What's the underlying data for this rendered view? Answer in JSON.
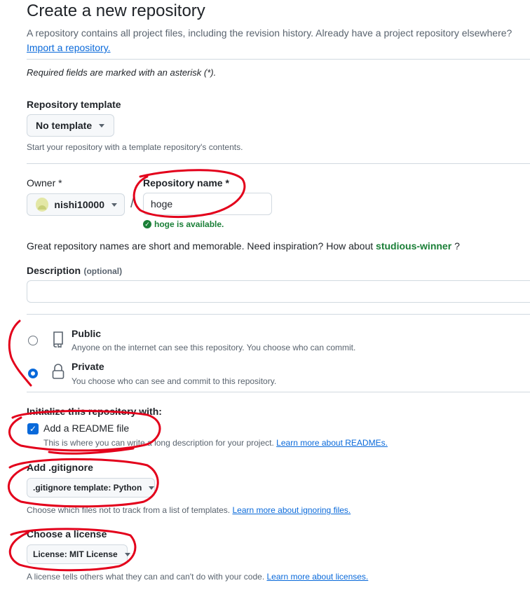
{
  "page": {
    "title": "Create a new repository",
    "intro_text": "A repository contains all project files, including the revision history. Already have a project repository elsewhere?",
    "import_link": "Import a repository.",
    "required_note": "Required fields are marked with an asterisk (*)."
  },
  "template": {
    "label": "Repository template",
    "selected": "No template",
    "hint": "Start your repository with a template repository's contents."
  },
  "owner": {
    "label": "Owner *",
    "selected": "nishi10000",
    "separator": "/"
  },
  "repo_name": {
    "label": "Repository name *",
    "value": "hoge",
    "status": "hoge is available.",
    "status_color": "#1a7f37"
  },
  "suggestion": {
    "text": "Great repository names are short and memorable. Need inspiration? How about",
    "name": "studious-winner",
    "suffix": "?"
  },
  "description": {
    "label": "Description",
    "optional": "(optional)",
    "value": ""
  },
  "visibility": {
    "options": [
      {
        "label": "Public",
        "desc": "Anyone on the internet can see this repository. You choose who can commit.",
        "selected": false,
        "icon": "repo-icon"
      },
      {
        "label": "Private",
        "desc": "You choose who can see and commit to this repository.",
        "selected": true,
        "icon": "lock-icon"
      }
    ]
  },
  "init": {
    "heading": "Initialize this repository with:",
    "readme_label": "Add a README file",
    "readme_checked": true,
    "readme_desc": "This is where you can write a long description for your project.",
    "readme_link": "Learn more about READMEs."
  },
  "gitignore": {
    "label": "Add .gitignore",
    "selected": ".gitignore template: Python",
    "hint": "Choose which files not to track from a list of templates.",
    "link": "Learn more about ignoring files."
  },
  "license": {
    "label": "Choose a license",
    "selected": "License: MIT License",
    "hint": "A license tells others what they can and can't do with your code.",
    "link": "Learn more about licenses."
  },
  "colors": {
    "accent": "#0969da",
    "success": "#1a7f37",
    "annotation": "#e3001b"
  }
}
